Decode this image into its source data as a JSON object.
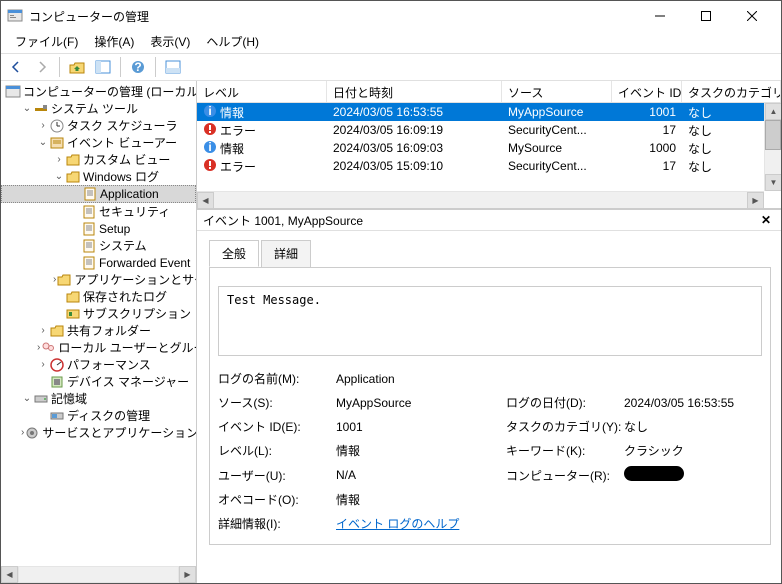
{
  "window": {
    "title": "コンピューターの管理"
  },
  "menu": {
    "file": "ファイル(F)",
    "action": "操作(A)",
    "view": "表示(V)",
    "help": "ヘルプ(H)"
  },
  "tree": {
    "root": "コンピューターの管理 (ローカル)",
    "system_tools": "システム ツール",
    "task_scheduler": "タスク スケジューラ",
    "event_viewer": "イベント ビューアー",
    "custom_views": "カスタム ビュー",
    "windows_logs": "Windows ログ",
    "application": "Application",
    "security": "セキュリティ",
    "setup": "Setup",
    "system": "システム",
    "forwarded": "Forwarded Event",
    "apps_svcs": "アプリケーションとサービ",
    "saved_logs": "保存されたログ",
    "subscriptions": "サブスクリプション",
    "shared_folders": "共有フォルダー",
    "local_users": "ローカル ユーザーとグループ",
    "performance": "パフォーマンス",
    "device_manager": "デバイス マネージャー",
    "storage": "記憶域",
    "disk_management": "ディスクの管理",
    "services_apps": "サービスとアプリケーション"
  },
  "columns": {
    "level": "レベル",
    "datetime": "日付と時刻",
    "source": "ソース",
    "event_id": "イベント ID",
    "category": "タスクのカテゴリ"
  },
  "rows": [
    {
      "level": "情報",
      "icon": "info",
      "datetime": "2024/03/05 16:53:55",
      "source": "MyAppSource",
      "event_id": "1001",
      "category": "なし",
      "selected": true
    },
    {
      "level": "エラー",
      "icon": "error",
      "datetime": "2024/03/05 16:09:19",
      "source": "SecurityCent...",
      "event_id": "17",
      "category": "なし"
    },
    {
      "level": "情報",
      "icon": "info",
      "datetime": "2024/03/05 16:09:03",
      "source": "MySource",
      "event_id": "1000",
      "category": "なし"
    },
    {
      "level": "エラー",
      "icon": "error",
      "datetime": "2024/03/05 15:09:10",
      "source": "SecurityCent...",
      "event_id": "17",
      "category": "なし"
    }
  ],
  "detail": {
    "title": "イベント 1001, MyAppSource",
    "tabs": {
      "general": "全般",
      "details": "詳細"
    },
    "message": "Test Message.",
    "labels": {
      "log_name": "ログの名前(M):",
      "source": "ソース(S):",
      "event_id": "イベント ID(E):",
      "level": "レベル(L):",
      "user": "ユーザー(U):",
      "opcode": "オペコード(O):",
      "more_info": "詳細情報(I):",
      "logged": "ログの日付(D):",
      "category": "タスクのカテゴリ(Y):",
      "keywords": "キーワード(K):",
      "computer": "コンピューター(R):"
    },
    "values": {
      "log_name": "Application",
      "source": "MyAppSource",
      "event_id": "1001",
      "level": "情報",
      "user": "N/A",
      "opcode": "情報",
      "more_info": "イベント ログのヘルプ",
      "logged": "2024/03/05 16:53:55",
      "category": "なし",
      "keywords": "クラシック"
    }
  }
}
